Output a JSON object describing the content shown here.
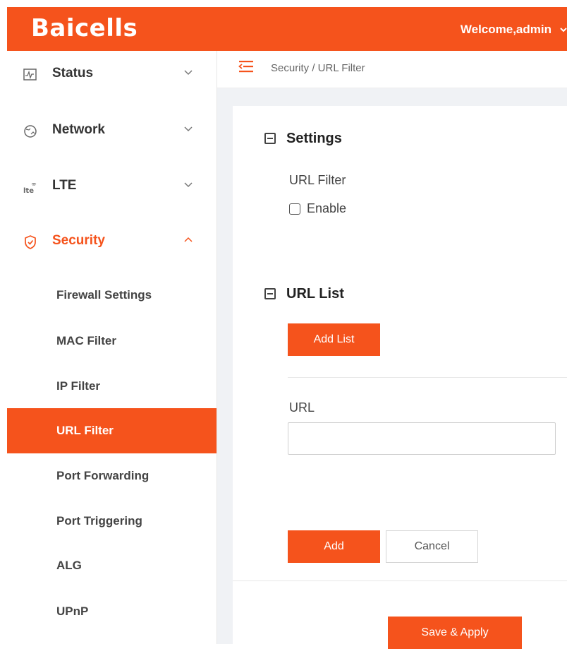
{
  "header": {
    "logo_text": "Baicells",
    "welcome": "Welcome,admin",
    "brand_color": "#f5531c"
  },
  "sidebar": {
    "items": [
      {
        "label": "Status",
        "icon": "status-icon",
        "expanded": false
      },
      {
        "label": "Network",
        "icon": "network-icon",
        "expanded": false
      },
      {
        "label": "LTE",
        "icon": "lte-icon",
        "expanded": false
      },
      {
        "label": "Security",
        "icon": "shield-icon",
        "expanded": true
      }
    ],
    "subitems": [
      {
        "label": "Firewall Settings"
      },
      {
        "label": "MAC Filter"
      },
      {
        "label": "IP Filter"
      },
      {
        "label": "URL Filter",
        "active": true
      },
      {
        "label": "Port Forwarding"
      },
      {
        "label": "Port Triggering"
      },
      {
        "label": "ALG"
      },
      {
        "label": "UPnP"
      }
    ]
  },
  "breadcrumb": "Security / URL Filter",
  "settings": {
    "title": "Settings",
    "url_filter_label": "URL Filter",
    "enable_label": "Enable",
    "enabled": false
  },
  "url_list": {
    "title": "URL List",
    "add_list_button": "Add List",
    "url_label": "URL",
    "url_value": "",
    "add_button": "Add",
    "cancel_button": "Cancel"
  },
  "footer": {
    "save_button": "Save & Apply"
  }
}
